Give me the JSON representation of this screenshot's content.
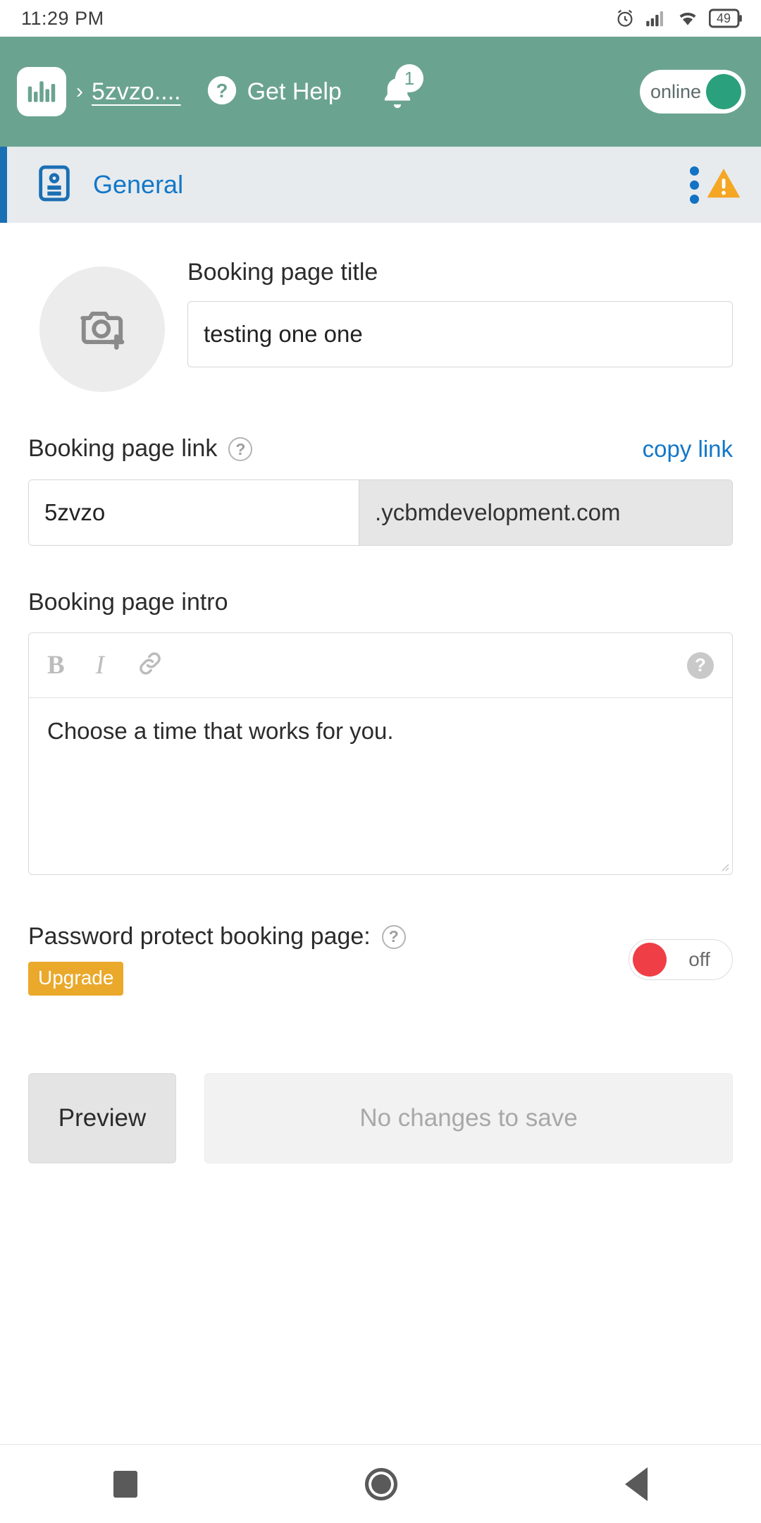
{
  "status_bar": {
    "time": "11:29 PM",
    "battery_level": "49",
    "icons": [
      "alarm-icon",
      "signal-icon",
      "wifi-icon",
      "battery-icon"
    ]
  },
  "app_bar": {
    "logo": "ycbm-logo",
    "separator": "›",
    "breadcrumb": "5zvzo....",
    "help_label": "Get Help",
    "help_icon": "question-circle-icon",
    "notification_icon": "bell-icon",
    "notification_count": "1",
    "status_toggle": {
      "label": "online",
      "state": "on",
      "accent": "#2aa17c"
    },
    "background": "#6ba391"
  },
  "section_bar": {
    "icon": "contact-card-icon",
    "title": "General",
    "accent": "#1377c7",
    "menu_icon": "kebab-menu-icon",
    "warning_icon": "warning-triangle-icon",
    "warning_color": "#f5a623",
    "background": "#e7ebee"
  },
  "form": {
    "avatar": {
      "icon": "camera-add-icon",
      "background": "#ececec"
    },
    "title_field": {
      "label": "Booking page title",
      "value": "testing one one",
      "placeholder": "Booking page title"
    },
    "link_field": {
      "label": "Booking page link",
      "help_icon": "question-circle-icon",
      "copy_action": "copy link",
      "value": "5zvzo",
      "placeholder": "5zvzo",
      "domain_suffix": ".ycbmdevelopment.com"
    },
    "intro_field": {
      "label": "Booking page intro",
      "toolbar": {
        "bold": "B",
        "italic": "I",
        "link_icon": "link-icon",
        "help_icon": "question-circle-icon"
      },
      "value": "Choose a time that works for you.",
      "placeholder": "Booking page intro"
    },
    "password_protect": {
      "label": "Password protect booking page:",
      "help_icon": "question-circle-icon",
      "toggle_state": "off",
      "toggle_label": "off",
      "toggle_color": "#ef3e45",
      "badge": "Upgrade",
      "badge_color": "#eaa92b"
    },
    "actions": {
      "preview_label": "Preview",
      "save_label": "No changes to save",
      "save_enabled": "false"
    }
  },
  "nav_bar": {
    "recents": "square-icon",
    "home": "circle-icon",
    "back": "triangle-back-icon"
  }
}
